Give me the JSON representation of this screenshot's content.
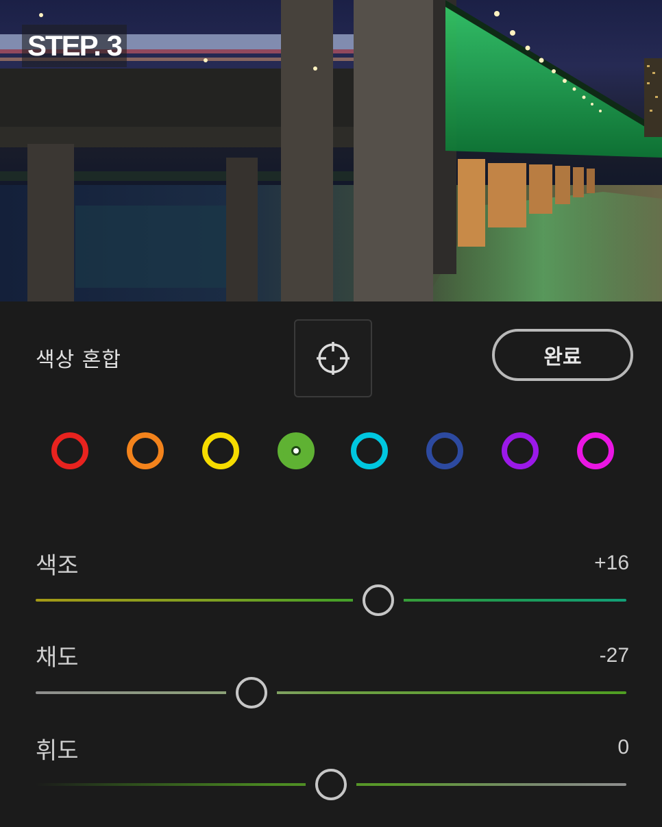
{
  "photo": {
    "step_badge": "STEP. 3"
  },
  "header": {
    "title": "색상 혼합",
    "done_label": "완료",
    "target_icon": "target-crosshair-icon"
  },
  "colors": {
    "swatches": [
      {
        "name": "red",
        "hex": "#e8231f",
        "selected": false
      },
      {
        "name": "orange",
        "hex": "#f3831c",
        "selected": false
      },
      {
        "name": "yellow",
        "hex": "#f6dc00",
        "selected": false
      },
      {
        "name": "green",
        "hex": "#5fb233",
        "selected": true
      },
      {
        "name": "aqua",
        "hex": "#00c7e0",
        "selected": false
      },
      {
        "name": "blue",
        "hex": "#2d4aa0",
        "selected": false
      },
      {
        "name": "purple",
        "hex": "#9b19e8",
        "selected": false
      },
      {
        "name": "magenta",
        "hex": "#ea16e3",
        "selected": false
      }
    ]
  },
  "sliders": {
    "hue": {
      "label": "색조",
      "value": "+16",
      "numeric": 16,
      "min": -100,
      "max": 100
    },
    "saturation": {
      "label": "채도",
      "value": "-27",
      "numeric": -27,
      "min": -100,
      "max": 100
    },
    "luminance": {
      "label": "휘도",
      "value": "0",
      "numeric": 0,
      "min": -100,
      "max": 100
    }
  }
}
